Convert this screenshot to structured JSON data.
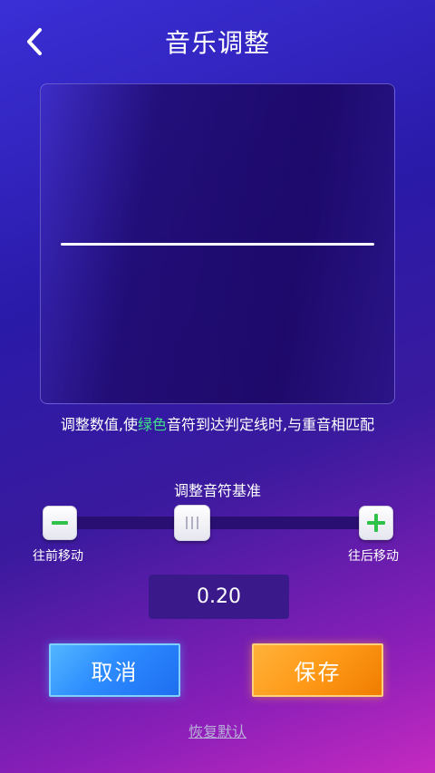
{
  "header": {
    "title": "音乐调整"
  },
  "hint": {
    "before": "调整数值,使",
    "highlight": "绿色",
    "after": "音符到达判定线时,与重音相匹配"
  },
  "slider": {
    "label": "调整音符基准",
    "left_label": "往前移动",
    "right_label": "往后移动",
    "position_fraction": 0.42
  },
  "value": {
    "display": "0.20"
  },
  "buttons": {
    "cancel": "取消",
    "save": "保存",
    "restore": "恢复默认"
  },
  "colors": {
    "highlight_green": "#3fe08a",
    "cancel_blue": "#2d8cff",
    "save_orange": "#ff9a18",
    "icon_green": "#2fc24a"
  }
}
